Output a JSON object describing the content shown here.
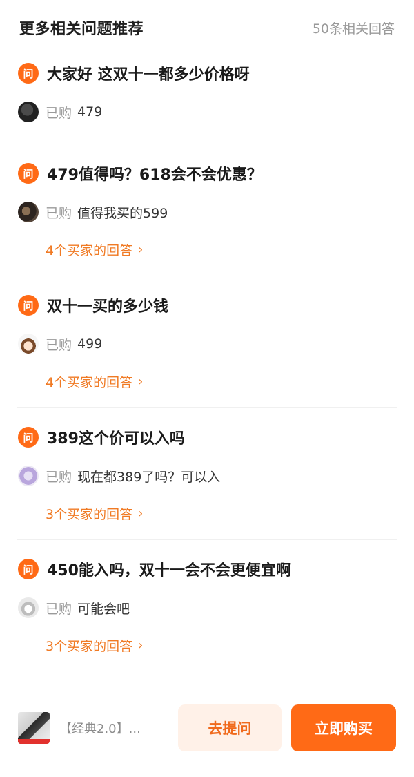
{
  "header": {
    "title": "更多相关问题推荐",
    "count": "50条相关回答"
  },
  "question_badge": "问",
  "bought_label": "已购",
  "questions": [
    {
      "q": "大家好 这双十一都多少价格呀",
      "answer": "479",
      "more": ""
    },
    {
      "q": "479值得吗？618会不会优惠？",
      "answer": "值得我买的599",
      "more": "4个买家的回答"
    },
    {
      "q": "双十一买的多少钱",
      "answer": "499",
      "more": "4个买家的回答"
    },
    {
      "q": "389这个价可以入吗",
      "answer": "现在都389了吗？可以入",
      "more": "3个买家的回答"
    },
    {
      "q": "450能入吗，双十一会不会更便宜啊",
      "answer": "可能会吧",
      "more": "3个买家的回答"
    }
  ],
  "bottom_bar": {
    "product_name": "【经典2.0】...",
    "ask_label": "去提问",
    "buy_label": "立即购买"
  },
  "colors": {
    "accent": "#ff6a16",
    "link": "#f07a24",
    "muted": "#9a9a9a"
  },
  "icons": {
    "question_badge": "question-badge-icon",
    "chevron": "chevron-right-icon"
  }
}
